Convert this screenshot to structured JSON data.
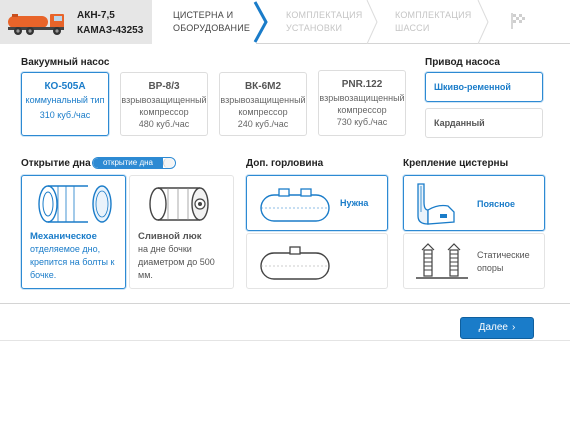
{
  "header": {
    "vehicle_line1": "АКН-7,5",
    "vehicle_line2": "КАМАЗ-43253",
    "steps": [
      {
        "line1": "Цистерна и",
        "line2": "оборудование"
      },
      {
        "line1": "Комплектация",
        "line2": "установки"
      },
      {
        "line1": "Комплектация",
        "line2": "шасси"
      }
    ],
    "active_step": 1
  },
  "pump": {
    "title": "Вакуумный насос",
    "options": [
      {
        "name": "КО-505А",
        "desc1": "коммунальный тип",
        "desc2": "",
        "desc3": "310 куб./час",
        "selected": true
      },
      {
        "name": "ВР-8/3",
        "desc1": "взрывозащищенный",
        "desc2": "компрессор",
        "desc3": "480 куб./час",
        "selected": false
      },
      {
        "name": "ВК-6М2",
        "desc1": "взрывозащищенный",
        "desc2": "компрессор",
        "desc3": "240 куб./час",
        "selected": false
      },
      {
        "name": "PNR.122",
        "desc1": "взрывозащищенный",
        "desc2": "компрессор",
        "desc3": "730 куб./час",
        "selected": false
      }
    ]
  },
  "drive": {
    "title": "Привод насоса",
    "options": [
      {
        "label": "Шкиво-ременной",
        "selected": true
      },
      {
        "label": "Карданный",
        "selected": false
      }
    ]
  },
  "bottom": {
    "title": "Открытие дна",
    "toggle_label": "открытие дна",
    "options": [
      {
        "name": "Механическое",
        "desc": "отделяемое дно, крепится на болты к бочке.",
        "selected": true
      },
      {
        "name": "Сливной люк",
        "desc": "на дне бочки диаметром до 500 мм.",
        "selected": false
      }
    ]
  },
  "neck": {
    "title": "Доп. горловина",
    "options": [
      {
        "label": "Нужна",
        "selected": true
      },
      {
        "label": "",
        "selected": false
      }
    ]
  },
  "mount": {
    "title": "Крепление цистерны",
    "options": [
      {
        "line1": "Поясное",
        "line2": "",
        "selected": true
      },
      {
        "line1": "Статические",
        "line2": "опоры",
        "selected": false
      }
    ]
  },
  "footer": {
    "next_label": "Далее",
    "next_arrow": "›"
  },
  "colors": {
    "accent": "#1a7cc9",
    "truck_orange": "#e8642a"
  }
}
